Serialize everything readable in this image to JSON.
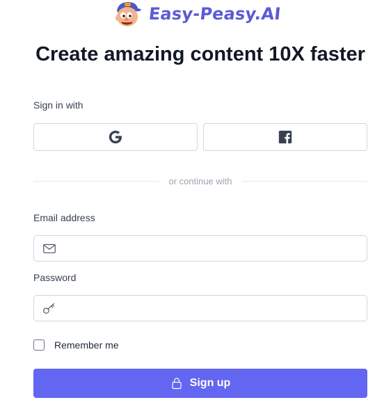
{
  "brand": {
    "name": "Easy-Peasy.AI",
    "logo_icon": "mascot-logo-icon",
    "color": "#5b5bd6"
  },
  "heading": "Create amazing content 10X faster",
  "social": {
    "label": "Sign in with",
    "providers": [
      {
        "name": "Google",
        "icon": "google-icon"
      },
      {
        "name": "Facebook",
        "icon": "facebook-icon"
      }
    ]
  },
  "divider": {
    "text": "or continue with"
  },
  "email": {
    "label": "Email address",
    "value": "",
    "placeholder": "",
    "icon": "mail-icon"
  },
  "password": {
    "label": "Password",
    "value": "",
    "placeholder": "",
    "icon": "key-icon"
  },
  "remember": {
    "label": "Remember me",
    "checked": false
  },
  "submit": {
    "label": "Sign up",
    "icon": "lock-icon",
    "color": "#6366f1"
  }
}
